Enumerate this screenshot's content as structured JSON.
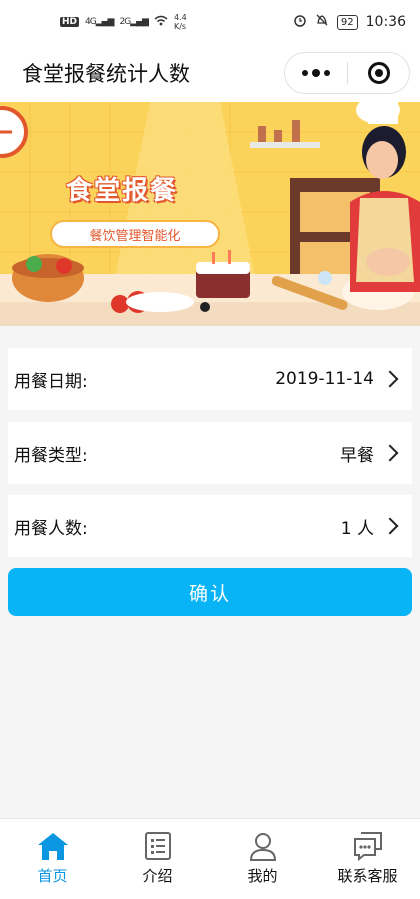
{
  "status": {
    "left_icons": [
      "HD",
      "4G",
      "2G",
      "wifi"
    ],
    "speed": "4.4",
    "speed_unit": "K/s",
    "battery": "92",
    "time": "10:36"
  },
  "nav": {
    "title": "食堂报餐统计人数"
  },
  "banner": {
    "title": "食堂报餐",
    "subtitle": "餐饮管理智能化"
  },
  "form": {
    "date": {
      "label": "用餐日期:",
      "value": "2019-11-14"
    },
    "type": {
      "label": "用餐类型:",
      "value": "早餐"
    },
    "count": {
      "label": "用餐人数:",
      "value": "1 人"
    }
  },
  "confirm_label": "确认",
  "tabs": [
    {
      "label": "首页",
      "icon": "home-icon",
      "active": true
    },
    {
      "label": "介绍",
      "icon": "list-doc-icon",
      "active": false
    },
    {
      "label": "我的",
      "icon": "user-icon",
      "active": false
    },
    {
      "label": "联系客服",
      "icon": "chat-icon",
      "active": false
    }
  ],
  "colors": {
    "accent": "#08b4f6",
    "tab_active": "#0a96e0",
    "banner_bg": "#fbd35a"
  }
}
